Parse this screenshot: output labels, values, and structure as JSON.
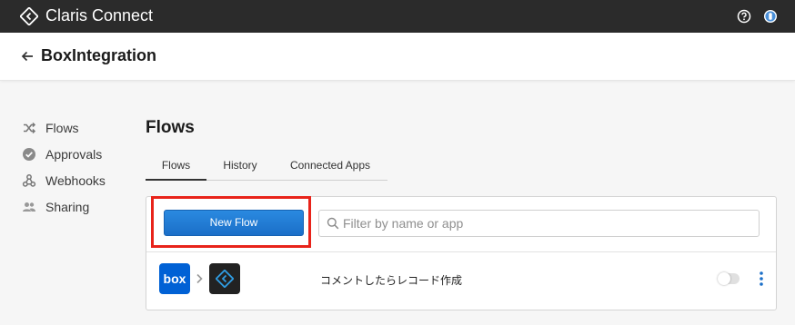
{
  "topbar": {
    "app_name": "Claris Connect",
    "help_icon": "help-icon",
    "user_icon": "user-icon"
  },
  "header": {
    "title": "BoxIntegration",
    "back_icon": "arrow-left-icon"
  },
  "sidebar": {
    "items": [
      {
        "label": "Flows",
        "icon": "shuffle-icon"
      },
      {
        "label": "Approvals",
        "icon": "check-circle-icon"
      },
      {
        "label": "Webhooks",
        "icon": "webhook-icon"
      },
      {
        "label": "Sharing",
        "icon": "people-icon"
      }
    ]
  },
  "main": {
    "section_title": "Flows",
    "tabs": [
      {
        "label": "Flows",
        "active": true
      },
      {
        "label": "History",
        "active": false
      },
      {
        "label": "Connected Apps",
        "active": false
      }
    ],
    "new_flow_label": "New Flow",
    "search": {
      "placeholder": "Filter by name or app",
      "value": ""
    },
    "flows": [
      {
        "source_app": "box",
        "target_app": "claris-connect-logo",
        "name": "コメントしたらレコード作成",
        "enabled": false
      }
    ]
  },
  "colors": {
    "topbar": "#2b2b2b",
    "primary_button": "#1b6fc8",
    "highlight": "#e8231a",
    "box_brand": "#0061d5",
    "info_icon": "#1b6fc8"
  }
}
